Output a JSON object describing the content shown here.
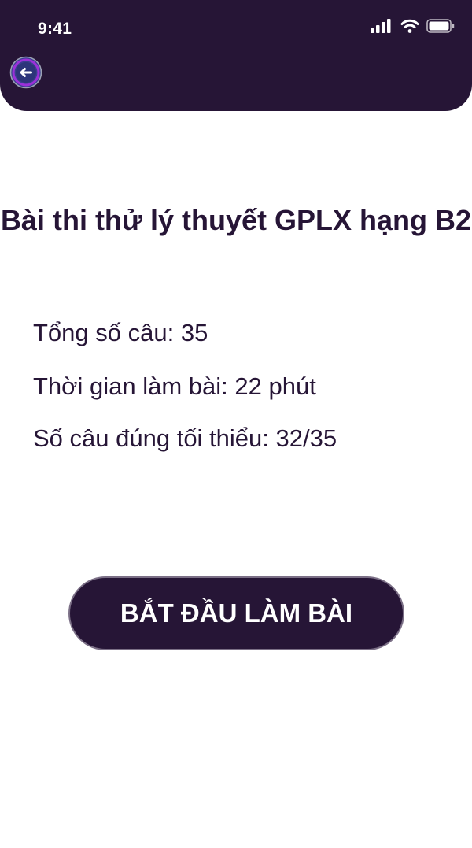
{
  "status_bar": {
    "time": "9:41",
    "icons": [
      "signal-icon",
      "wifi-icon",
      "battery-icon"
    ]
  },
  "header": {
    "back_icon": "arrow-left-icon"
  },
  "exam": {
    "title": "Bài thi thử lý thuyết GPLX hạng B2",
    "total_questions": "Tổng số câu: 35",
    "duration": "Thời gian làm bài: 22 phút",
    "min_correct": "Số câu đúng tối thiểu: 32/35"
  },
  "actions": {
    "start_label": "BẮT ĐẦU LÀM BÀI"
  },
  "colors": {
    "primary": "#261536",
    "background": "#ffffff",
    "back_ring": "#8a2be2",
    "back_fill": "#3a3f8f"
  }
}
